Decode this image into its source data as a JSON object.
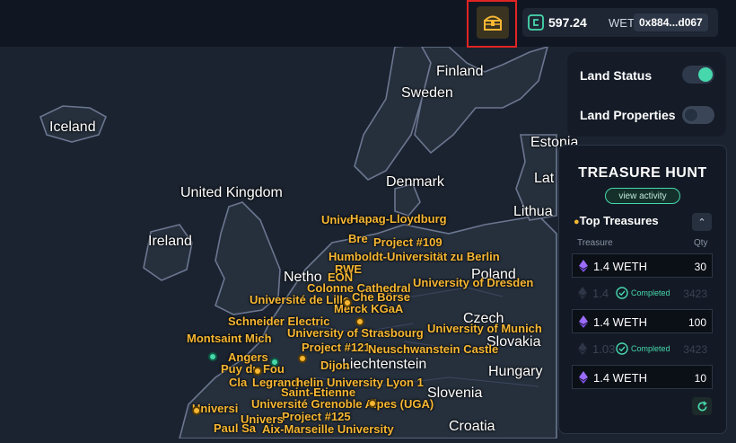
{
  "map": {
    "countries": [
      {
        "name": "Finland"
      },
      {
        "name": "Sweden"
      },
      {
        "name": "Iceland"
      },
      {
        "name": "Estonia"
      },
      {
        "name": "Denmark"
      },
      {
        "name": "United Kingdom"
      },
      {
        "name": "Lat"
      },
      {
        "name": "Lithua"
      },
      {
        "name": "Ireland"
      },
      {
        "name": "Poland"
      },
      {
        "name": "Czech"
      },
      {
        "name": "Slovakia"
      },
      {
        "name": "Liechtenstein"
      },
      {
        "name": "Hungary"
      },
      {
        "name": "Slovenia"
      },
      {
        "name": "Netho"
      },
      {
        "name": "Croatia"
      }
    ],
    "poi_labels": [
      "Unive",
      "Hapag-Lloydburg",
      "Project #109",
      "Bre",
      "Humboldt-Universität zu Berlin",
      "RWE",
      "EON",
      "University of Dresden",
      "Université de Lille",
      "Che Börse",
      "Colonne Cathedral",
      "Merck KGaA",
      "Schneider Electric",
      "Montsaint Mich",
      "University of Strasbourg",
      "Project #121",
      "Neuschwanstein Castle",
      "University of Munich",
      "Angers",
      "Puy du Fou",
      "Dijon",
      "Legrand",
      "helin University Lyon 1",
      "Universi",
      "Université Grenoble Alpes (UGA)",
      "Project #125",
      "Univers",
      "Paul Sa",
      "Aix-Marseille University",
      "Cla",
      "Saint-Etienne"
    ]
  },
  "topbar": {
    "chest_icon": "treasure-chest-icon",
    "wallet": {
      "amount": "597.24",
      "unit": "WETH",
      "address": "0x884...d067"
    }
  },
  "toggles": [
    {
      "label": "Land Status",
      "on": true
    },
    {
      "label": "Land Properties",
      "on": false
    }
  ],
  "treasure": {
    "title": "TREASURE HUNT",
    "activity_label": "view activity",
    "top_label": "Top Treasures",
    "col_treasure": "Treasure",
    "col_qty": "Qty",
    "rows": [
      {
        "amount": "1.4 WETH",
        "qty": "30",
        "status": "active"
      },
      {
        "amount": "1.4",
        "qty": "3423",
        "status": "completed",
        "badge": "Completed"
      },
      {
        "amount": "1.4 WETH",
        "qty": "100",
        "status": "active"
      },
      {
        "amount": "1.03",
        "qty": "3423",
        "status": "completed",
        "badge": "Completed"
      },
      {
        "amount": "1.4 WETH",
        "qty": "10",
        "status": "active"
      }
    ]
  },
  "colors": {
    "accent": "#47d7ac",
    "poi": "#f7b733",
    "panel": "#131a25",
    "highlight": "#e02424"
  }
}
